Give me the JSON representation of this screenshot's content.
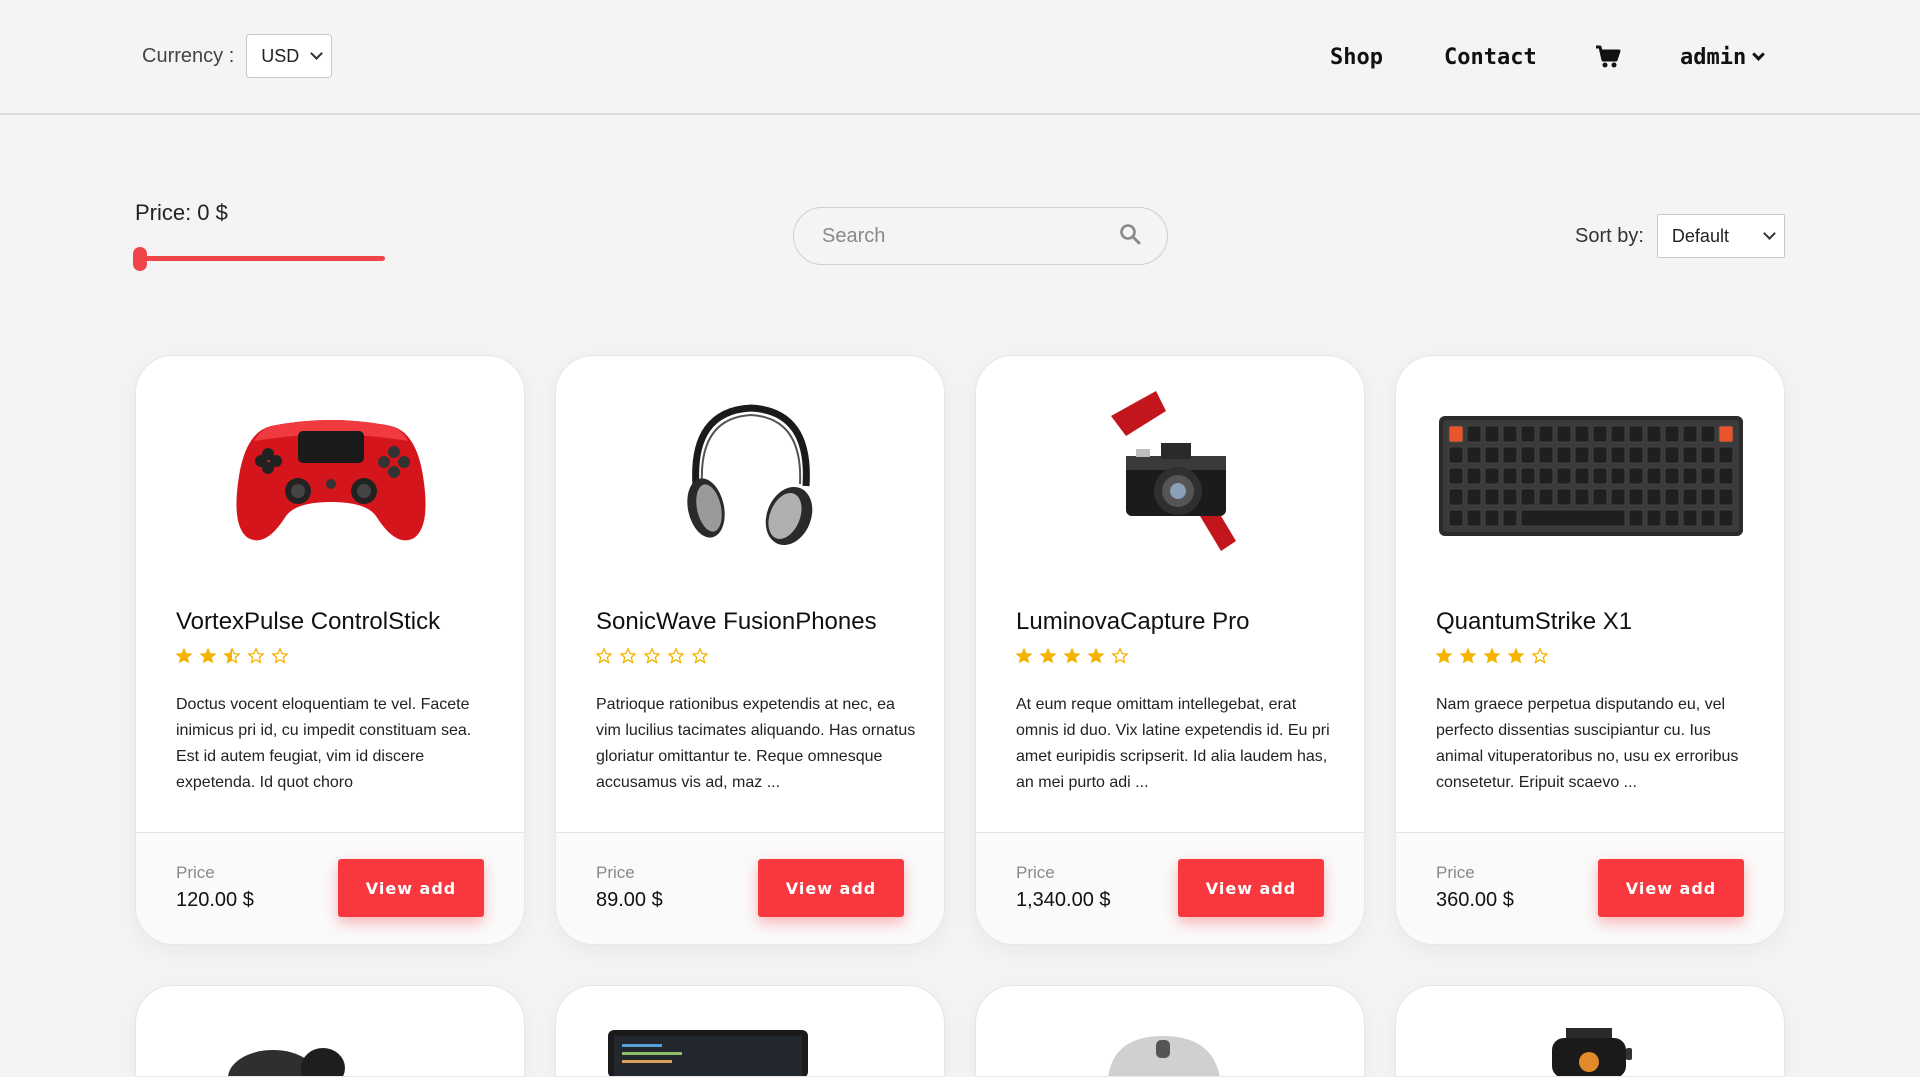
{
  "header": {
    "currency_label": "Currency :",
    "currency_value": "USD",
    "nav": {
      "shop": "Shop",
      "contact": "Contact",
      "user": "admin"
    },
    "cart_icon": "shopping-cart-icon"
  },
  "filters": {
    "price_label": "Price:",
    "price_value": "0 $",
    "price_fraction": 0,
    "search_placeholder": "Search",
    "sort_label": "Sort by:",
    "sort_value": "Default"
  },
  "colors": {
    "accent": "#f8383e",
    "star": "#f5b301",
    "background": "#f4f4f4"
  },
  "products": [
    {
      "title": "VortexPulse ControlStick",
      "rating": 2.5,
      "image": "red-gamepad",
      "description": "Doctus vocent eloquentiam te vel. Facete inimicus pri id, cu impedit constituam sea. Est id autem feugiat, vim id discere expetenda. Id quot choro",
      "price_caption": "Price",
      "price": "120.00 $",
      "button": "View add"
    },
    {
      "title": "SonicWave FusionPhones",
      "rating": 0,
      "image": "headphones",
      "description": "Patrioque rationibus expetendis at nec, ea vim lucilius tacimates aliquando. Has ornatus gloriatur omittantur te. Reque omnesque accusamus vis ad, maz ...",
      "price_caption": "Price",
      "price": "89.00 $",
      "button": "View add"
    },
    {
      "title": "LuminovaCapture Pro",
      "rating": 4,
      "image": "camera",
      "description": "At eum reque omittam intellegebat, erat omnis id duo. Vix latine expetendis id. Eu pri amet euripidis scripserit. Id alia laudem has, an mei purto adi ...",
      "price_caption": "Price",
      "price": "1,340.00 $",
      "button": "View add"
    },
    {
      "title": "QuantumStrike X1",
      "rating": 4,
      "image": "keyboard",
      "description": "Nam graece perpetua disputando eu, vel perfecto dissentias suscipiantur cu. Ius animal vituperatoribus no, usu ex erroribus consetetur. Eripuit scaevo ...",
      "price_caption": "Price",
      "price": "360.00 $",
      "button": "View add"
    }
  ],
  "next_row_images": [
    "earbuds",
    "laptop",
    "mouse",
    "smartwatch"
  ]
}
